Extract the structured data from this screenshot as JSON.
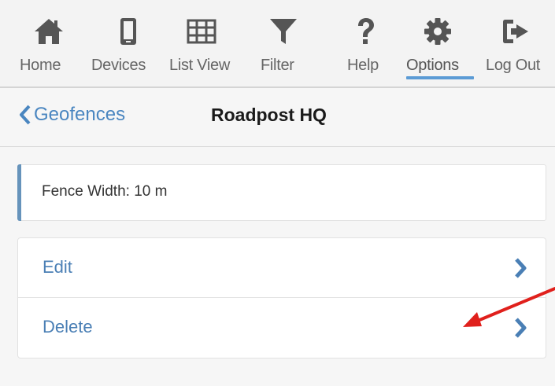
{
  "toolbar": {
    "items": [
      {
        "label": "Home",
        "icon": "home-icon"
      },
      {
        "label": "Devices",
        "icon": "mobile-phone-icon"
      },
      {
        "label": "List View",
        "icon": "grid-table-icon"
      },
      {
        "label": "Filter",
        "icon": "filter-funnel-icon"
      },
      {
        "label": "Help",
        "icon": "question-mark-icon"
      },
      {
        "label": "Options",
        "icon": "gear-icon",
        "active": true
      },
      {
        "label": "Log Out",
        "icon": "sign-out-icon"
      }
    ]
  },
  "navbar": {
    "back_label": "Geofences",
    "title": "Roadpost HQ"
  },
  "info": {
    "text": "Fence Width: 10 m"
  },
  "menu": {
    "items": [
      {
        "label": "Edit"
      },
      {
        "label": "Delete"
      }
    ]
  },
  "colors": {
    "icon": "#555555",
    "link": "#4a7fb5",
    "accent_underline": "#5b9bd5",
    "annotation_arrow": "#e0201c"
  }
}
